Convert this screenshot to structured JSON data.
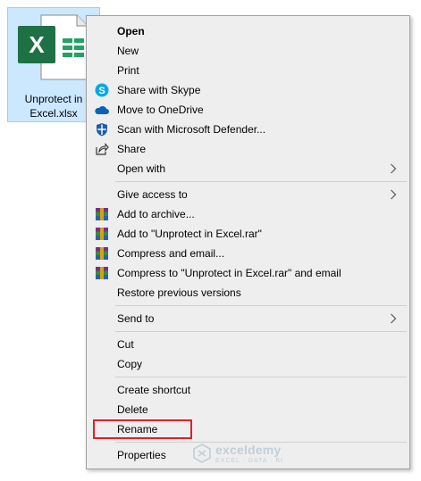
{
  "file": {
    "name_line1": "Unprotect in",
    "name_line2": "Excel.xlsx",
    "icon": "excel-file-icon"
  },
  "menu": {
    "items": [
      {
        "label": "Open",
        "icon": "",
        "bold": true
      },
      {
        "label": "New",
        "icon": ""
      },
      {
        "label": "Print",
        "icon": ""
      },
      {
        "label": "Share with Skype",
        "icon": "skype-icon"
      },
      {
        "label": "Move to OneDrive",
        "icon": "onedrive-icon"
      },
      {
        "label": "Scan with Microsoft Defender...",
        "icon": "defender-icon"
      },
      {
        "label": "Share",
        "icon": "share-icon"
      },
      {
        "label": "Open with",
        "icon": "",
        "submenu": true
      },
      {
        "label": "Give access to",
        "icon": "",
        "submenu": true
      },
      {
        "label": "Add to archive...",
        "icon": "winrar-icon"
      },
      {
        "label": "Add to \"Unprotect in Excel.rar\"",
        "icon": "winrar-icon"
      },
      {
        "label": "Compress and email...",
        "icon": "winrar-icon"
      },
      {
        "label": "Compress to \"Unprotect in Excel.rar\" and email",
        "icon": "winrar-icon"
      },
      {
        "label": "Restore previous versions",
        "icon": ""
      },
      {
        "label": "Send to",
        "icon": "",
        "submenu": true
      },
      {
        "label": "Cut",
        "icon": ""
      },
      {
        "label": "Copy",
        "icon": ""
      },
      {
        "label": "Create shortcut",
        "icon": ""
      },
      {
        "label": "Delete",
        "icon": ""
      },
      {
        "label": "Rename",
        "icon": "",
        "highlighted": true
      },
      {
        "label": "Properties",
        "icon": ""
      }
    ]
  },
  "watermark": {
    "brand": "exceldemy",
    "tagline": "EXCEL · DATA · BI"
  },
  "colors": {
    "menu_bg": "#eeeeee",
    "selection_bg": "#cce8ff",
    "highlight_border": "#e0202a",
    "excel_green": "#1e7145"
  }
}
